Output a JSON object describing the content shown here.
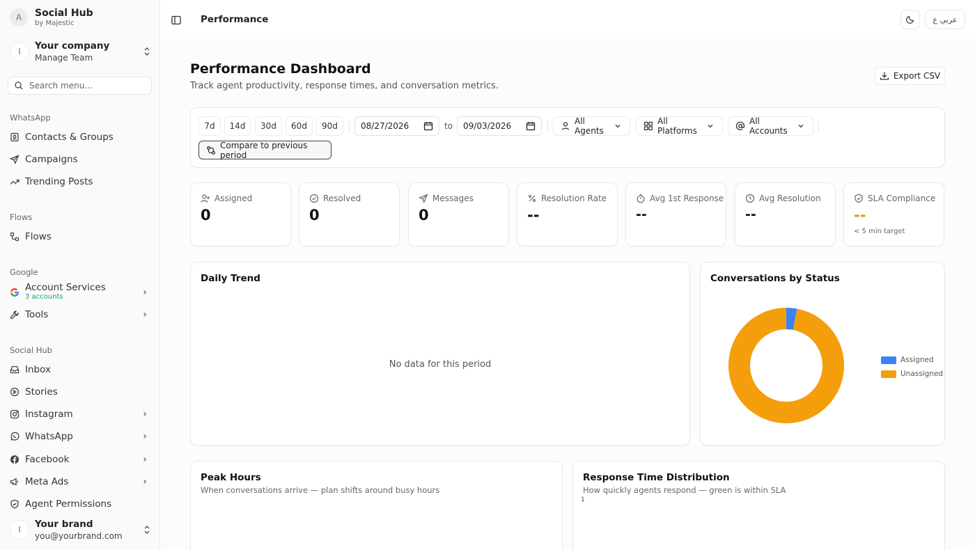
{
  "sidebar": {
    "brand": {
      "avatar": "A",
      "title": "Social Hub",
      "subtitle": "by Majestic"
    },
    "company": {
      "avatar": "I",
      "name": "Your company",
      "sub": "Manage Team"
    },
    "search_placeholder": "Search menu...",
    "sections": [
      {
        "title": "WhatsApp",
        "items": [
          {
            "label": "Contacts & Groups",
            "icon": "contacts-icon"
          },
          {
            "label": "Campaigns",
            "icon": "send-icon"
          },
          {
            "label": "Trending Posts",
            "icon": "trending-icon"
          }
        ]
      },
      {
        "title": "Flows",
        "items": [
          {
            "label": "Flows",
            "icon": "flows-icon"
          }
        ]
      },
      {
        "title": "Google",
        "items": [
          {
            "label": "Account Services",
            "sub": "3 accounts",
            "icon": "google-icon"
          },
          {
            "label": "Tools",
            "icon": "wrench-icon"
          }
        ]
      },
      {
        "title": "Social Hub",
        "items": [
          {
            "label": "Inbox",
            "icon": "inbox-icon"
          },
          {
            "label": "Stories",
            "icon": "play-icon"
          },
          {
            "label": "Instagram",
            "icon": "instagram-icon"
          },
          {
            "label": "WhatsApp",
            "icon": "whatsapp-icon"
          },
          {
            "label": "Facebook",
            "icon": "facebook-icon"
          },
          {
            "label": "Meta Ads",
            "icon": "megaphone-icon"
          },
          {
            "label": "Agent Permissions",
            "icon": "shield-icon"
          }
        ]
      }
    ],
    "user": {
      "avatar": "I",
      "name": "Your brand",
      "email": "you@yourbrand.com"
    }
  },
  "topbar": {
    "title": "Performance",
    "lang": "عربي ع"
  },
  "header": {
    "title": "Performance Dashboard",
    "subtitle": "Track agent productivity, response times, and conversation metrics.",
    "export_label": "Export CSV"
  },
  "filters": {
    "ranges": [
      "7d",
      "14d",
      "30d",
      "60d",
      "90d"
    ],
    "date_from": "08/27/2026",
    "to_label": "to",
    "date_to": "09/03/2026",
    "agents": "All Agents",
    "platforms": "All Platforms",
    "accounts": "All Accounts",
    "compare": "Compare to previous period"
  },
  "stats": [
    {
      "label": "Assigned",
      "value": "0",
      "icon": "user-plus-icon"
    },
    {
      "label": "Resolved",
      "value": "0",
      "icon": "check-circle-icon"
    },
    {
      "label": "Messages",
      "value": "0",
      "icon": "send-icon"
    },
    {
      "label": "Resolution Rate",
      "value": "--",
      "icon": "percent-icon"
    },
    {
      "label": "Avg 1st Response",
      "value": "--",
      "icon": "timer-icon"
    },
    {
      "label": "Avg Resolution",
      "value": "--",
      "icon": "clock-icon"
    },
    {
      "label": "SLA Compliance",
      "value": "--",
      "note": "< 5 min target",
      "icon": "shield-check-icon"
    }
  ],
  "colors": {
    "sla_value": "#e8930c",
    "assigned": "#3b82f6",
    "unassigned": "#f59e0b"
  },
  "daily_trend": {
    "title": "Daily Trend",
    "empty": "No data for this period"
  },
  "status_chart": {
    "title": "Conversations by Status",
    "chart_data": {
      "type": "pie",
      "labels": [
        "Assigned",
        "Unassigned"
      ],
      "values": [
        3,
        97
      ],
      "colors": [
        "#3b82f6",
        "#f59e0b"
      ],
      "legend": "right"
    }
  },
  "peak_hours": {
    "title": "Peak Hours",
    "subtitle": "When conversations arrive — plan shifts around busy hours"
  },
  "response_dist": {
    "title": "Response Time Distribution",
    "subtitle": "How quickly agents respond — green is within SLA",
    "axis_top": "1"
  }
}
